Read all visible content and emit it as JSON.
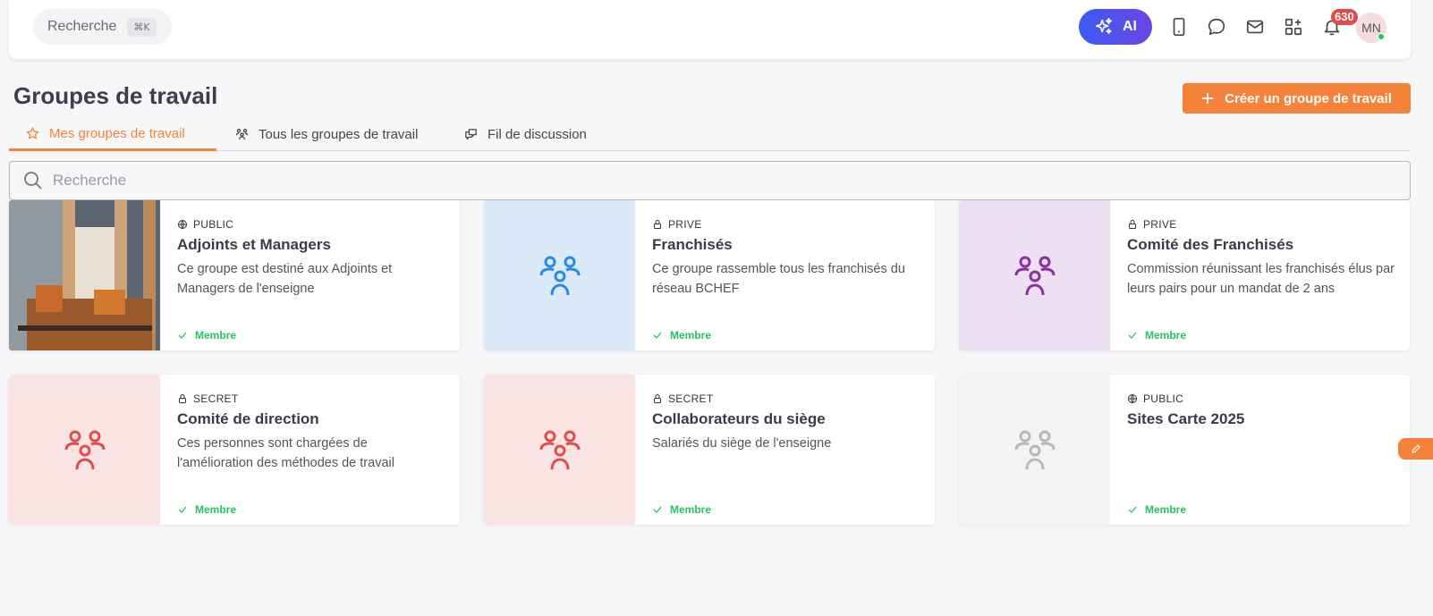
{
  "topbar": {
    "search_label": "Recherche",
    "search_shortcut": "⌘K",
    "ai_label": "AI",
    "notifications_count": "630",
    "avatar_initials": "MN"
  },
  "page": {
    "title": "Groupes de travail",
    "create_button": "Créer un groupe de travail"
  },
  "tabs": [
    {
      "label": "Mes groupes de travail",
      "icon": "star-icon",
      "active": true
    },
    {
      "label": "Tous les groupes de travail",
      "icon": "people-icon",
      "active": false
    },
    {
      "label": "Fil de discussion",
      "icon": "chat-thread-icon",
      "active": false
    }
  ],
  "search": {
    "placeholder": "Recherche"
  },
  "groups": [
    {
      "privacy": "PUBLIC",
      "privacy_icon": "globe-icon",
      "title": "Adjoints et Managers",
      "description": "Ce groupe est destiné aux Adjoints et Managers de l'enseigne",
      "status": "Membre",
      "thumb": "photo",
      "thumb_color": "#9a6a4a",
      "icon_color": ""
    },
    {
      "privacy": "PRIVE",
      "privacy_icon": "lock-icon",
      "title": "Franchisés",
      "description": "Ce groupe rassemble tous les franchisés du réseau BCHEF",
      "status": "Membre",
      "thumb": "icon",
      "thumb_color": "#dbeaf9",
      "icon_color": "#2b8ae0"
    },
    {
      "privacy": "PRIVE",
      "privacy_icon": "lock-icon",
      "title": "Comité des Franchisés",
      "description": "Commission réunissant les franchisés élus par leurs pairs pour un mandat de 2 ans",
      "status": "Membre",
      "thumb": "icon",
      "thumb_color": "#ece0f2",
      "icon_color": "#8b2fa8"
    },
    {
      "privacy": "SECRET",
      "privacy_icon": "lock-icon",
      "title": "Comité de direction",
      "description": "Ces personnes sont chargées de l'amélioration des méthodes de travail",
      "status": "Membre",
      "thumb": "icon",
      "thumb_color": "#fae3e3",
      "icon_color": "#e14c4c"
    },
    {
      "privacy": "SECRET",
      "privacy_icon": "lock-icon",
      "title": "Collaborateurs du siège",
      "description": "Salariés du siège de l'enseigne",
      "status": "Membre",
      "thumb": "icon",
      "thumb_color": "#fae3e3",
      "icon_color": "#e14c4c"
    },
    {
      "privacy": "PUBLIC",
      "privacy_icon": "globe-icon",
      "title": "Sites Carte 2025",
      "description": "",
      "status": "Membre",
      "thumb": "icon",
      "thumb_color": "#f3f3f3",
      "icon_color": "#b9b9b9"
    }
  ],
  "colors": {
    "accent": "#f5823a",
    "member_green": "#22c55e",
    "ai_gradient_start": "#3b5bf2",
    "ai_gradient_end": "#6b46e5"
  }
}
